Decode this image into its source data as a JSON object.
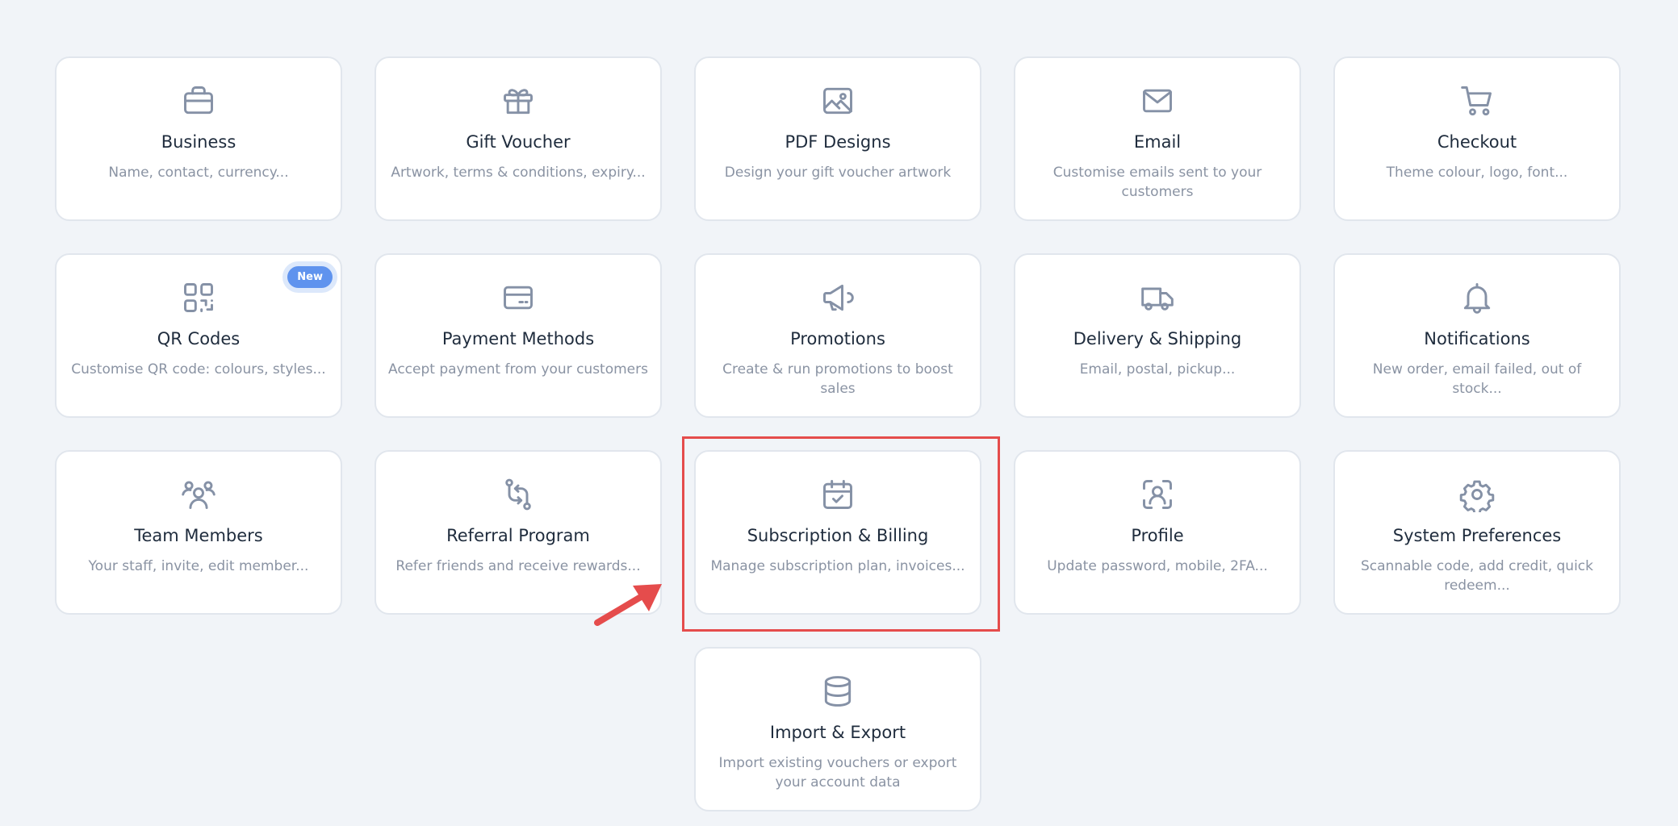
{
  "colors": {
    "background": "#f1f4f8",
    "card": "#ffffff",
    "title": "#1f2c3d",
    "description": "#8a93a3",
    "icon": "#8591a6",
    "badge": "#5f93ee",
    "highlight": "#e54c4c"
  },
  "cards": {
    "business": {
      "icon": "briefcase-icon",
      "title": "Business",
      "desc": "Name, contact, currency..."
    },
    "gift_voucher": {
      "icon": "gift-icon",
      "title": "Gift Voucher",
      "desc": "Artwork, terms & conditions, expiry..."
    },
    "pdf_designs": {
      "icon": "image-icon",
      "title": "PDF Designs",
      "desc": "Design your gift voucher artwork"
    },
    "email": {
      "icon": "envelope-icon",
      "title": "Email",
      "desc": "Customise emails sent to your customers"
    },
    "checkout": {
      "icon": "cart-icon",
      "title": "Checkout",
      "desc": "Theme colour, logo, font..."
    },
    "qr_codes": {
      "icon": "qr-code-icon",
      "title": "QR Codes",
      "desc": "Customise QR code: colours, styles...",
      "badge": "New"
    },
    "payment_methods": {
      "icon": "credit-card-icon",
      "title": "Payment Methods",
      "desc": "Accept payment from your customers"
    },
    "promotions": {
      "icon": "megaphone-icon",
      "title": "Promotions",
      "desc": "Create & run promotions to boost sales"
    },
    "delivery": {
      "icon": "truck-icon",
      "title": "Delivery & Shipping",
      "desc": "Email, postal, pickup..."
    },
    "notifications": {
      "icon": "bell-icon",
      "title": "Notifications",
      "desc": "New order, email failed, out of stock..."
    },
    "team_members": {
      "icon": "users-icon",
      "title": "Team Members",
      "desc": "Your staff, invite, edit member..."
    },
    "referral": {
      "icon": "arrows-exchange-icon",
      "title": "Referral Program",
      "desc": "Refer friends and receive rewards..."
    },
    "subscription": {
      "icon": "calendar-check-icon",
      "title": "Subscription & Billing",
      "desc": "Manage subscription plan, invoices..."
    },
    "profile": {
      "icon": "user-scan-icon",
      "title": "Profile",
      "desc": "Update password, mobile, 2FA..."
    },
    "system_preferences": {
      "icon": "gear-icon",
      "title": "System Preferences",
      "desc": "Scannable code, add credit, quick redeem..."
    },
    "import_export": {
      "icon": "database-icon",
      "title": "Import & Export",
      "desc": "Import existing vouchers or export your account data"
    }
  }
}
